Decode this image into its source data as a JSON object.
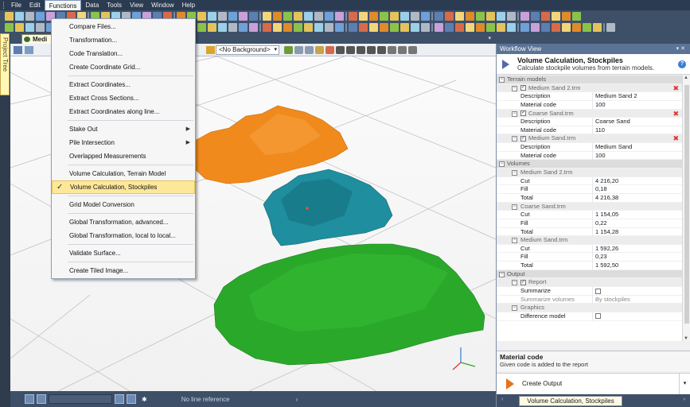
{
  "menubar": {
    "items": [
      "File",
      "Edit",
      "Functions",
      "Data",
      "Tools",
      "View",
      "Window",
      "Help"
    ],
    "active_index": 2
  },
  "functions_menu": {
    "groups": [
      [
        {
          "label": "Compare Files..."
        },
        {
          "label": "Transformation..."
        },
        {
          "label": "Code Translation..."
        },
        {
          "label": "Create Coordinate Grid..."
        }
      ],
      [
        {
          "label": "Extract Coordinates..."
        },
        {
          "label": "Extract Cross Sections..."
        },
        {
          "label": "Extract Coordinates along line..."
        }
      ],
      [
        {
          "label": "Stake Out",
          "submenu": true
        },
        {
          "label": "Pile Intersection",
          "submenu": true
        },
        {
          "label": "Overlapped Measurements"
        }
      ],
      [
        {
          "label": "Volume Calculation, Terrain Model"
        },
        {
          "label": "Volume Calculation, Stockpiles",
          "checked": true,
          "highlighted": true
        }
      ],
      [
        {
          "label": "Grid Model Conversion"
        }
      ],
      [
        {
          "label": "Global Transformation, advanced..."
        },
        {
          "label": "Global Transformation, local to local..."
        }
      ],
      [
        {
          "label": "Validate Surface..."
        }
      ],
      [
        {
          "label": "Create Tiled Image..."
        }
      ]
    ]
  },
  "project_tree": {
    "label": "Project Tree"
  },
  "document": {
    "tab_label": "Medi"
  },
  "view_toolbar": {
    "background_select": "<No Background>"
  },
  "status_bar": {
    "line_reference": "No line reference"
  },
  "workflow": {
    "header": "Workflow View",
    "header_buttons": "▾ ✕",
    "title": "Volume Calculation, Stockpiles",
    "subtitle": "Calculate stockpile volumes from terrain models.",
    "help": "?",
    "rows": [
      {
        "type": "cat",
        "label": "Terrain models"
      },
      {
        "type": "sub",
        "label": "Medium Sand 2.trm",
        "checkbox": true,
        "delete": true
      },
      {
        "type": "prop",
        "key": "Description",
        "value": "Medium Sand 2"
      },
      {
        "type": "prop",
        "key": "Material code",
        "value": "100"
      },
      {
        "type": "sub",
        "label": "Coarse Sand.trm",
        "checkbox": true,
        "delete": true
      },
      {
        "type": "prop",
        "key": "Description",
        "value": "Coarse Sand"
      },
      {
        "type": "prop",
        "key": "Material code",
        "value": "110"
      },
      {
        "type": "sub",
        "label": "Medium Sand.trm",
        "checkbox": true,
        "delete": true
      },
      {
        "type": "prop",
        "key": "Description",
        "value": "Medium Sand"
      },
      {
        "type": "prop",
        "key": "Material code",
        "value": "100"
      },
      {
        "type": "cat",
        "label": "Volumes"
      },
      {
        "type": "sub",
        "label": "Medium Sand 2.trm"
      },
      {
        "type": "prop",
        "key": "Cut",
        "value": "4 216,20"
      },
      {
        "type": "prop",
        "key": "Fill",
        "value": "0,18"
      },
      {
        "type": "prop",
        "key": "Total",
        "value": "4 216,38"
      },
      {
        "type": "sub",
        "label": "Coarse Sand.trm"
      },
      {
        "type": "prop",
        "key": "Cut",
        "value": "1 154,05"
      },
      {
        "type": "prop",
        "key": "Fill",
        "value": "0,22"
      },
      {
        "type": "prop",
        "key": "Total",
        "value": "1 154,28"
      },
      {
        "type": "sub",
        "label": "Medium Sand.trm"
      },
      {
        "type": "prop",
        "key": "Cut",
        "value": "1 592,26"
      },
      {
        "type": "prop",
        "key": "Fill",
        "value": "0,23"
      },
      {
        "type": "prop",
        "key": "Total",
        "value": "1 592,50"
      },
      {
        "type": "cat",
        "label": "Output"
      },
      {
        "type": "sub",
        "label": "Report",
        "checkbox": true
      },
      {
        "type": "prop",
        "key": "Summarize",
        "value": "",
        "value_checkbox": true
      },
      {
        "type": "prop",
        "key": "Summarize volumes",
        "value": "By stockpiles",
        "grey": true
      },
      {
        "type": "sub",
        "label": "Graphics"
      },
      {
        "type": "prop",
        "key": "Difference model",
        "value": "",
        "value_checkbox": true
      }
    ],
    "description_title": "Material code",
    "description_text": "Given code is added to the report",
    "create_output": "Create Output",
    "bottom_tab": "Volume Calculation, Stockpiles"
  },
  "colors": {
    "stockpile_orange": "#f08a1c",
    "stockpile_teal": "#1f8e9e",
    "stockpile_green": "#2aa82a",
    "menu_highlight": "#fde89a"
  }
}
